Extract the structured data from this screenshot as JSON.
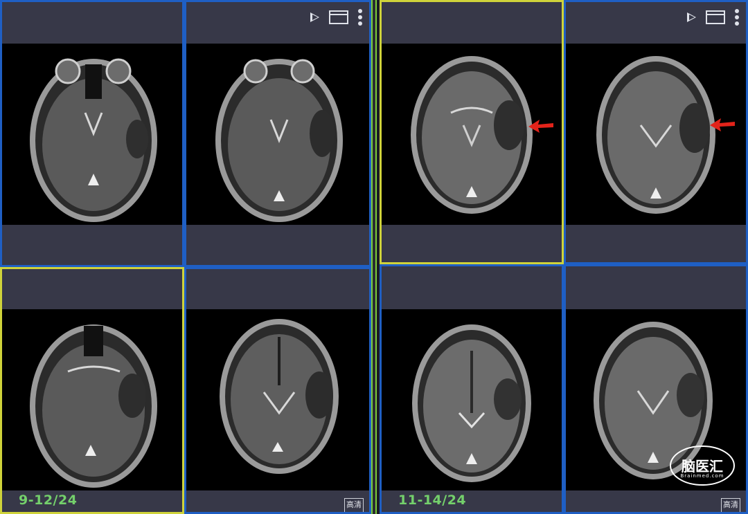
{
  "groups": [
    {
      "date_label": "9-12/24"
    },
    {
      "date_label": "11-14/24"
    }
  ],
  "cells": {
    "hd_badge": "高清"
  },
  "watermark": {
    "name": "脑医汇",
    "sub": "Brainmed.com"
  },
  "icons": {
    "play": "play-icon",
    "window": "window-icon",
    "more": "more-vertical-icon",
    "arrow": "red-arrow-annotation"
  },
  "colors": {
    "active_border": "#cfd33a",
    "panel_border": "#1f5fc4",
    "group_separator": "#7ccd39",
    "date_text": "#74d06b",
    "annotation_arrow": "#e2231a"
  }
}
